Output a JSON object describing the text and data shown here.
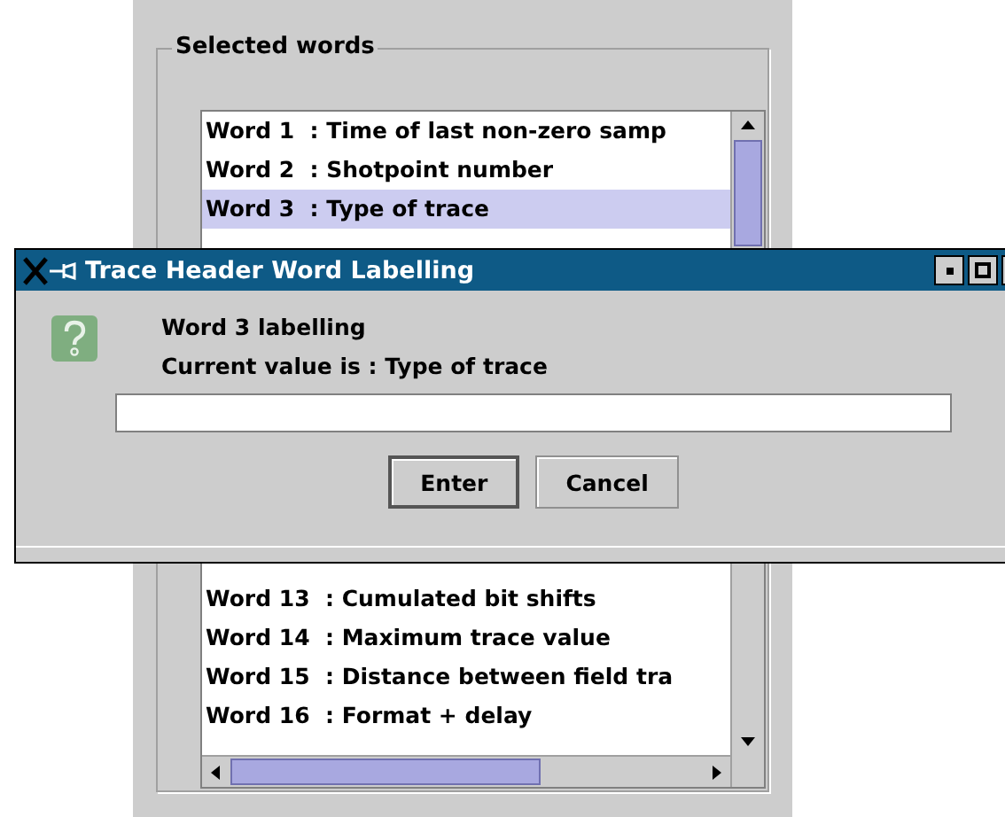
{
  "panel": {
    "legend": "Selected words"
  },
  "list": {
    "rows_above_dialog": [
      {
        "text": "Word 1  : Time of last non-zero samp",
        "selected": false
      },
      {
        "text": "Word 2  : Shotpoint number",
        "selected": false
      },
      {
        "text": "Word 3  : Type of trace",
        "selected": true
      }
    ],
    "rows_below_dialog": [
      {
        "text": "Word 13  : Cumulated bit shifts",
        "selected": false
      },
      {
        "text": "Word 14  : Maximum trace value",
        "selected": false
      },
      {
        "text": "Word 15  : Distance between field tra",
        "selected": false
      },
      {
        "text": "Word 16  : Format + delay",
        "selected": false
      }
    ]
  },
  "dialog": {
    "title": "Trace Header Word Labelling",
    "heading": "Word 3 labelling",
    "message": "Current value is : Type of trace",
    "buttons": [
      {
        "label": "Enter",
        "default": true
      },
      {
        "label": "Cancel",
        "default": false
      }
    ]
  }
}
